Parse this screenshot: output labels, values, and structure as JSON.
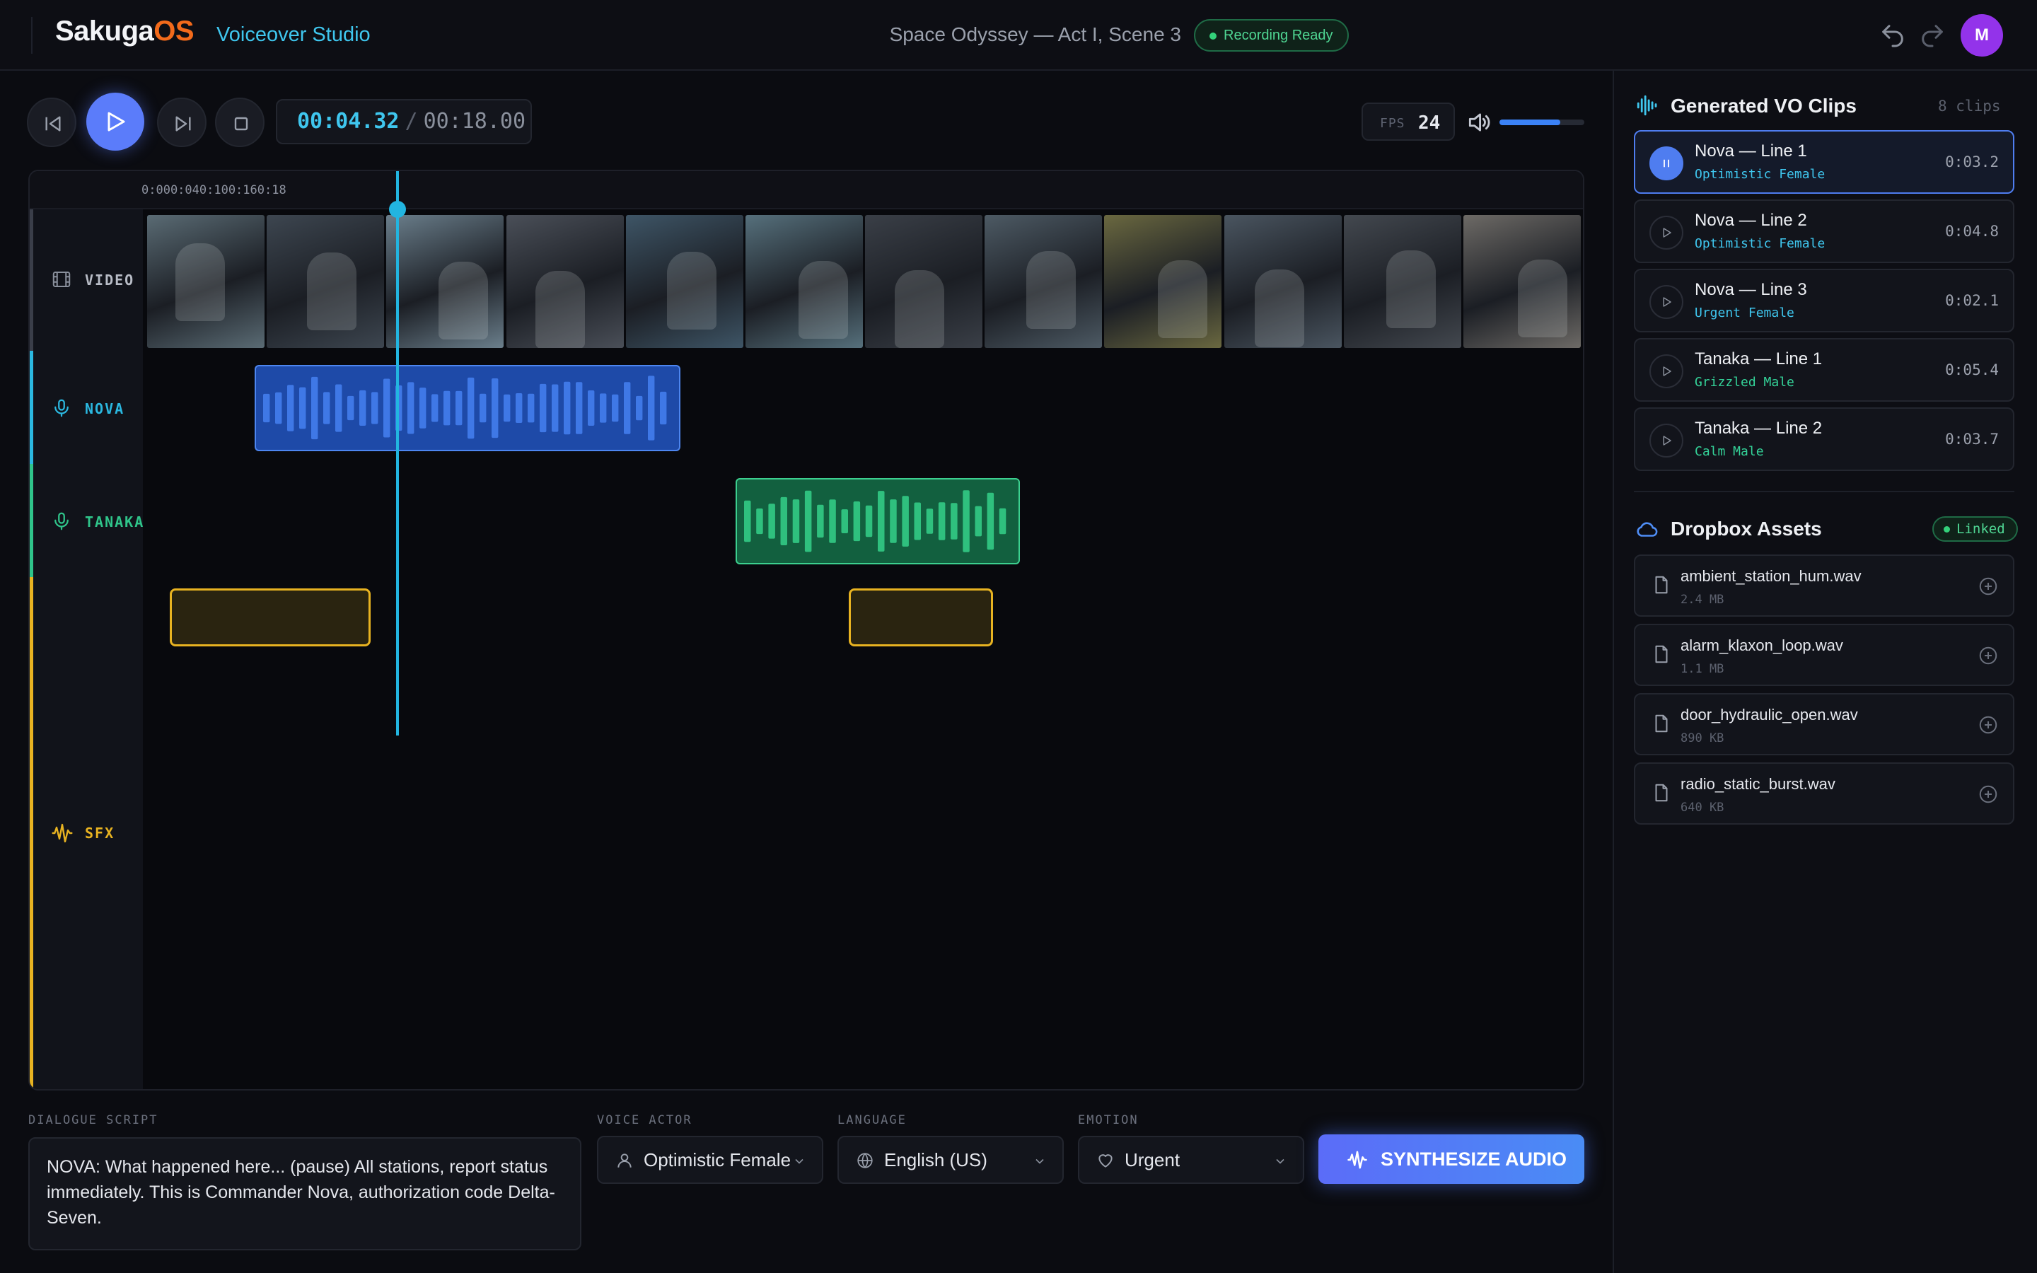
{
  "app": {
    "brand_a": "Sakuga",
    "brand_b": "OS",
    "module": "Voiceover Studio"
  },
  "header": {
    "project": "Space Odyssey — Act I, Scene 3",
    "status": "Recording Ready",
    "avatar_initial": "M"
  },
  "transport": {
    "current_time": "00:04.32",
    "separator": "/",
    "total_time": "00:18.00",
    "fps_label": "FPS",
    "fps_value": "24",
    "volume_level": 0.72
  },
  "timeline": {
    "ruler_text": "0:000:040:100:160:18",
    "tracks": [
      {
        "id": "video",
        "label": "VIDEO",
        "color": "#5a5f6c"
      },
      {
        "id": "nova",
        "label": "NOVA",
        "color": "#2bb8e0"
      },
      {
        "id": "tanaka",
        "label": "TANAKA",
        "color": "#2fc48a"
      },
      {
        "id": "sfx",
        "label": "SFX",
        "color": "#e8b321"
      }
    ],
    "frames_count": 12
  },
  "editor": {
    "script_label": "DIALOGUE SCRIPT",
    "script_text": "NOVA: What happened here... (pause) All stations, report status immediately. This is Commander Nova, authorization code Delta-Seven.",
    "voice_label": "VOICE ACTOR",
    "voice_value": "Optimistic Female",
    "language_label": "LANGUAGE",
    "language_value": "English (US)",
    "emotion_label": "EMOTION",
    "emotion_value": "Urgent",
    "synth_label": "SYNTHESIZE AUDIO"
  },
  "vo_clips": {
    "title": "Generated VO Clips",
    "count": "8 clips",
    "items": [
      {
        "name": "Nova — Line 1",
        "voice": "Optimistic Female",
        "duration": "0:03.2",
        "voice_color": "#3fc6ee"
      },
      {
        "name": "Nova — Line 2",
        "voice": "Optimistic Female",
        "duration": "0:04.8",
        "voice_color": "#3fc6ee"
      },
      {
        "name": "Nova — Line 3",
        "voice": "Urgent Female",
        "duration": "0:02.1",
        "voice_color": "#3fc6ee"
      },
      {
        "name": "Tanaka — Line 1",
        "voice": "Grizzled Male",
        "duration": "0:05.4",
        "voice_color": "#34d399"
      },
      {
        "name": "Tanaka — Line 2",
        "voice": "Calm Male",
        "duration": "0:03.7",
        "voice_color": "#34d399"
      }
    ]
  },
  "dropbox": {
    "title": "Dropbox Assets",
    "status": "Linked",
    "items": [
      {
        "name": "ambient_station_hum.wav",
        "size": "2.4 MB"
      },
      {
        "name": "alarm_klaxon_loop.wav",
        "size": "1.1 MB"
      },
      {
        "name": "door_hydraulic_open.wav",
        "size": "890 KB"
      },
      {
        "name": "radio_static_burst.wav",
        "size": "640 KB"
      }
    ]
  },
  "colors": {
    "accent": "#3fc6ee",
    "brand": "#f26a1b",
    "primary": "#5b7cfa",
    "success": "#33d17a",
    "sfx": "#e8b321"
  }
}
